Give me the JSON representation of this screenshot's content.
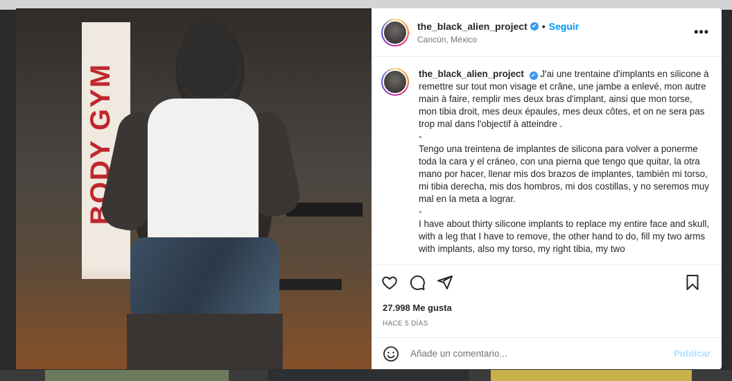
{
  "post": {
    "photo_wall_text": "BODY GYM",
    "header": {
      "username": "the_black_alien_project",
      "verified_glyph": "✔",
      "separator": "•",
      "follow_label": "Seguir",
      "location": "Cancún, México",
      "more_icon": "more-options-icon"
    },
    "caption": {
      "username": "the_black_alien_project",
      "text": "J'ai une trentaine d'implants en silicone à remettre sur tout mon visage et crâne, une jambe a enlevé, mon autre main à faire, remplir mes deux bras d'implant, ainsi que mon torse, mon tibia droit, mes deux épaules, mes deux côtes, et on ne sera pas trop mal dans l'objectif à atteindre .\n-\nTengo una treintena de implantes de silicona para volver a ponerme toda la cara y el cráneo, con una pierna que tengo que quitar, la otra mano por hacer, llenar mis dos brazos de implantes, también mi torso, mi tibia derecha, mis dos hombros, mi dos costillas, y no seremos muy mal en la meta a lograr.\n-\nI have about thirty silicone implants to replace my entire face and skull, with a leg that I have to remove, the other hand to do, fill my two arms with implants, also my torso, my right tibia, my two"
    },
    "actions": {
      "like_icon": "heart-icon",
      "comment_icon": "comment-icon",
      "share_icon": "share-icon",
      "save_icon": "bookmark-icon"
    },
    "likes": "27.998 Me gusta",
    "timestamp": "HACE 5 DÍAS",
    "comment_box": {
      "emoji_icon": "emoji-icon",
      "placeholder": "Añade un comentario...",
      "publish_label": "Publicar"
    }
  },
  "colors": {
    "accent": "#0095f6",
    "publish_disabled": "#b2dffc",
    "muted": "#737373"
  }
}
